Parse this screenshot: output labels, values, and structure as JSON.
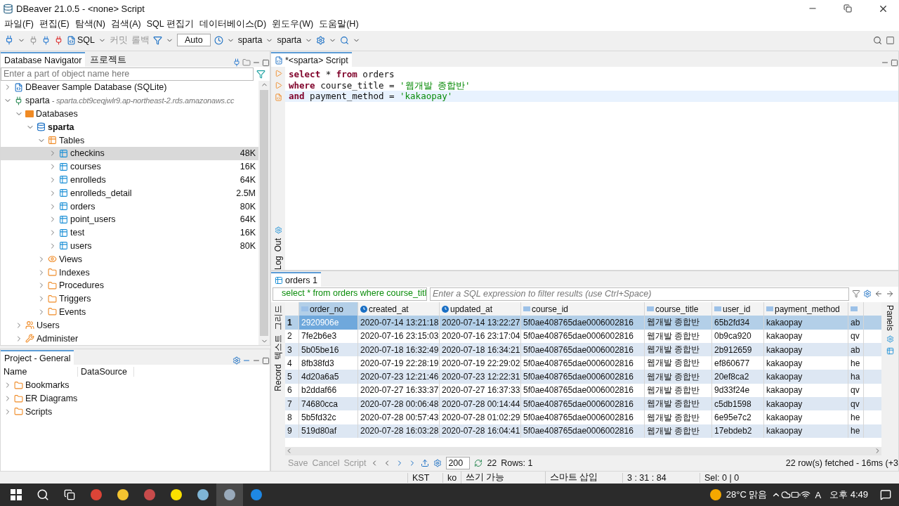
{
  "window": {
    "title": "DBeaver 21.0.5 - <none> Script"
  },
  "menu": [
    "파일(F)",
    "편집(E)",
    "탐색(N)",
    "검색(A)",
    "SQL 편집기",
    "데이터베이스(D)",
    "윈도우(W)",
    "도움말(H)"
  ],
  "toolbar": {
    "sql": "SQL",
    "commit": "커밋",
    "rollback": "롤백",
    "mode": "Auto",
    "datasource": "sparta",
    "schema": "sparta"
  },
  "navigator": {
    "tabs": [
      {
        "label": "Database Navigator",
        "selected": true
      },
      {
        "label": "프로젝트",
        "selected": false
      }
    ],
    "filter_placeholder": "Enter a part of object name here",
    "tree": [
      {
        "label": "DBeaver Sample Database (SQLite)",
        "kind": "sqlite",
        "expanded": false
      },
      {
        "label": "sparta",
        "detail": "- sparta.cbt9ceqjwlr9.ap-northeast-2.rds.amazonaws.cc",
        "kind": "connection",
        "expanded": true,
        "children": [
          {
            "label": "Databases",
            "kind": "databases",
            "expanded": true,
            "children": [
              {
                "label": "sparta",
                "kind": "schema",
                "active": true,
                "expanded": true,
                "children": [
                  {
                    "label": "Tables",
                    "kind": "tables",
                    "expanded": true,
                    "children": [
                      {
                        "label": "checkins",
                        "kind": "table",
                        "size": "48K",
                        "expanded": false,
                        "selected": true
                      },
                      {
                        "label": "courses",
                        "kind": "table",
                        "size": "16K",
                        "expanded": false,
                        "selected": false
                      },
                      {
                        "label": "enrolleds",
                        "kind": "table",
                        "size": "64K",
                        "expanded": false,
                        "selected": false
                      },
                      {
                        "label": "enrolleds_detail",
                        "kind": "table",
                        "size": "2.5M",
                        "expanded": false,
                        "selected": false
                      },
                      {
                        "label": "orders",
                        "kind": "table",
                        "size": "80K",
                        "expanded": false,
                        "selected": false
                      },
                      {
                        "label": "point_users",
                        "kind": "table",
                        "size": "64K",
                        "expanded": false,
                        "selected": false
                      },
                      {
                        "label": "test",
                        "kind": "table",
                        "size": "16K",
                        "expanded": false,
                        "selected": false
                      },
                      {
                        "label": "users",
                        "kind": "table",
                        "size": "80K",
                        "expanded": false,
                        "selected": false
                      }
                    ]
                  },
                  {
                    "label": "Views",
                    "kind": "views",
                    "expanded": false
                  },
                  {
                    "label": "Indexes",
                    "kind": "folder",
                    "expanded": false
                  },
                  {
                    "label": "Procedures",
                    "kind": "folder",
                    "expanded": false
                  },
                  {
                    "label": "Triggers",
                    "kind": "folder",
                    "expanded": false
                  },
                  {
                    "label": "Events",
                    "kind": "folder",
                    "expanded": false
                  }
                ]
              }
            ]
          },
          {
            "label": "Users",
            "kind": "users",
            "expanded": false
          },
          {
            "label": "Administer",
            "kind": "admin",
            "expanded": false
          }
        ]
      }
    ]
  },
  "project": {
    "title": "Project - General",
    "columns": [
      "Name",
      "DataSource"
    ],
    "items": [
      {
        "label": "Bookmarks",
        "expanded": false
      },
      {
        "label": "ER Diagrams",
        "expanded": false
      },
      {
        "label": "Scripts",
        "expanded": false
      }
    ]
  },
  "editor": {
    "tab": "*<sparta> Script",
    "side_tabs": [
      "Out",
      "Log"
    ],
    "lines": [
      {
        "current": false,
        "tokens": [
          {
            "kind": "keyword",
            "text": "select"
          },
          {
            "kind": "plain",
            "text": " * "
          },
          {
            "kind": "keyword",
            "text": "from"
          },
          {
            "kind": "plain",
            "text": " orders"
          }
        ]
      },
      {
        "current": false,
        "tokens": [
          {
            "kind": "keyword",
            "text": "where"
          },
          {
            "kind": "plain",
            "text": " course_title = "
          },
          {
            "kind": "string",
            "text": "'웹개발 종합반'"
          }
        ]
      },
      {
        "current": true,
        "tokens": [
          {
            "kind": "keyword",
            "text": "and"
          },
          {
            "kind": "plain",
            "text": " payment_method = "
          },
          {
            "kind": "string",
            "text": "'kakaopay'"
          }
        ]
      }
    ]
  },
  "results": {
    "tab": "orders 1",
    "query": "select * from orders where course_titl",
    "filter_placeholder": "Enter a SQL expression to filter results (use Ctrl+Space)",
    "side_tabs": [
      "그리드",
      "텍스트",
      "Record"
    ],
    "panels": "Panels",
    "columns": [
      {
        "name": "order_no",
        "kind": "text"
      },
      {
        "name": "created_at",
        "kind": "datetime"
      },
      {
        "name": "updated_at",
        "kind": "datetime"
      },
      {
        "name": "course_id",
        "kind": "text"
      },
      {
        "name": "course_title",
        "kind": "text"
      },
      {
        "name": "user_id",
        "kind": "text"
      },
      {
        "name": "payment_method",
        "kind": "text"
      },
      {
        "kind": "text"
      }
    ],
    "rows": [
      {
        "num": "1",
        "selected": true,
        "cells": [
          "2920906e",
          "2020-07-14 13:21:18",
          "2020-07-14 13:22:27",
          "5f0ae408765dae0006002816",
          "웹개발 종합반",
          "65b2fd34",
          "kakaopay",
          "ab"
        ]
      },
      {
        "num": "2",
        "selected": false,
        "cells": [
          "7fe2b6e3",
          "2020-07-16 23:15:03",
          "2020-07-16 23:17:04",
          "5f0ae408765dae0006002816",
          "웹개발 종합반",
          "0b9ca920",
          "kakaopay",
          "qv"
        ]
      },
      {
        "num": "3",
        "selected": false,
        "cells": [
          "5b05be16",
          "2020-07-18 16:32:49",
          "2020-07-18 16:34:21",
          "5f0ae408765dae0006002816",
          "웹개발 종합반",
          "2b912659",
          "kakaopay",
          "ab"
        ]
      },
      {
        "num": "4",
        "selected": false,
        "cells": [
          "8fb38fd3",
          "2020-07-19 22:28:19",
          "2020-07-19 22:29:02",
          "5f0ae408765dae0006002816",
          "웹개발 종합반",
          "ef860677",
          "kakaopay",
          "he"
        ]
      },
      {
        "num": "5",
        "selected": false,
        "cells": [
          "4d20a6a5",
          "2020-07-23 12:21:46",
          "2020-07-23 12:22:31",
          "5f0ae408765dae0006002816",
          "웹개발 종합반",
          "20ef8ca2",
          "kakaopay",
          "ha"
        ]
      },
      {
        "num": "6",
        "selected": false,
        "cells": [
          "b2ddaf66",
          "2020-07-27 16:33:37",
          "2020-07-27 16:37:33",
          "5f0ae408765dae0006002816",
          "웹개발 종합반",
          "9d33f24e",
          "kakaopay",
          "qv"
        ]
      },
      {
        "num": "7",
        "selected": false,
        "cells": [
          "74680cca",
          "2020-07-28 00:06:48",
          "2020-07-28 00:14:44",
          "5f0ae408765dae0006002816",
          "웹개발 종합반",
          "c5db1598",
          "kakaopay",
          "qv"
        ]
      },
      {
        "num": "8",
        "selected": false,
        "cells": [
          "5b5fd32c",
          "2020-07-28 00:57:43",
          "2020-07-28 01:02:29",
          "5f0ae408765dae0006002816",
          "웹개발 종합반",
          "6e95e7c2",
          "kakaopay",
          "he"
        ]
      },
      {
        "num": "9",
        "selected": false,
        "cells": [
          "519d80af",
          "2020-07-28 16:03:28",
          "2020-07-28 16:04:41",
          "5f0ae408765dae0006002816",
          "웹개발 종합반",
          "17ebdeb2",
          "kakaopay",
          "he"
        ]
      }
    ],
    "footer": {
      "save": "Save",
      "cancel": "Cancel",
      "script": "Script",
      "fetch_size": "200",
      "count": "22",
      "rows_label": "Rows: 1",
      "fetched": "22 row(s) fetched - 16ms (+3"
    }
  },
  "status_bar": [
    "KST",
    "ko",
    "쓰기 가능",
    "스마트 삽입",
    "3 : 31 : 84",
    "Sel: 0 | 0"
  ],
  "taskbar": {
    "weather": "28°C 맑음",
    "ime": "A",
    "time": "오후 4:49"
  }
}
